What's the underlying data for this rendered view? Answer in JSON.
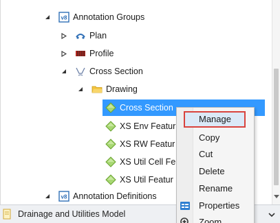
{
  "tree": {
    "items": [
      {
        "label": "Annotation Groups",
        "icon": "annotation-group-icon",
        "expander": "expanded"
      },
      {
        "label": "Plan",
        "icon": "plan-view-icon",
        "expander": "collapsed"
      },
      {
        "label": "Profile",
        "icon": "profile-view-icon",
        "expander": "collapsed"
      },
      {
        "label": "Cross Section",
        "icon": "cross-section-icon",
        "expander": "expanded"
      },
      {
        "label": "Drawing",
        "icon": "folder-icon",
        "expander": "expanded"
      },
      {
        "label": "Cross Section",
        "icon": "feature-diamond-icon",
        "selected": true
      },
      {
        "label": "XS Env Featur",
        "icon": "feature-diamond-icon"
      },
      {
        "label": "XS RW Featur",
        "icon": "feature-diamond-icon"
      },
      {
        "label": "XS Util Cell Fe",
        "icon": "feature-diamond-icon"
      },
      {
        "label": "XS Util Featur",
        "icon": "feature-diamond-icon"
      },
      {
        "label": "Annotation Definitions",
        "icon": "annotation-group-icon",
        "expander": "expanded"
      }
    ]
  },
  "context_menu": {
    "items": [
      {
        "label": "Manage",
        "highlighted": true
      },
      {
        "label": "Copy"
      },
      {
        "label": "Cut"
      },
      {
        "label": "Delete"
      },
      {
        "label": "Rename"
      },
      {
        "label": "Properties",
        "icon": "properties-icon"
      },
      {
        "label": "Zoom",
        "icon": "zoom-icon"
      }
    ]
  },
  "status": {
    "label": "Drainage and Utilities Model",
    "icon": "model-icon"
  },
  "colors": {
    "selection": "#3399ff",
    "highlight_border": "#d9433d",
    "feature_diamond": "#7ac143",
    "folder": "#f4c542"
  }
}
